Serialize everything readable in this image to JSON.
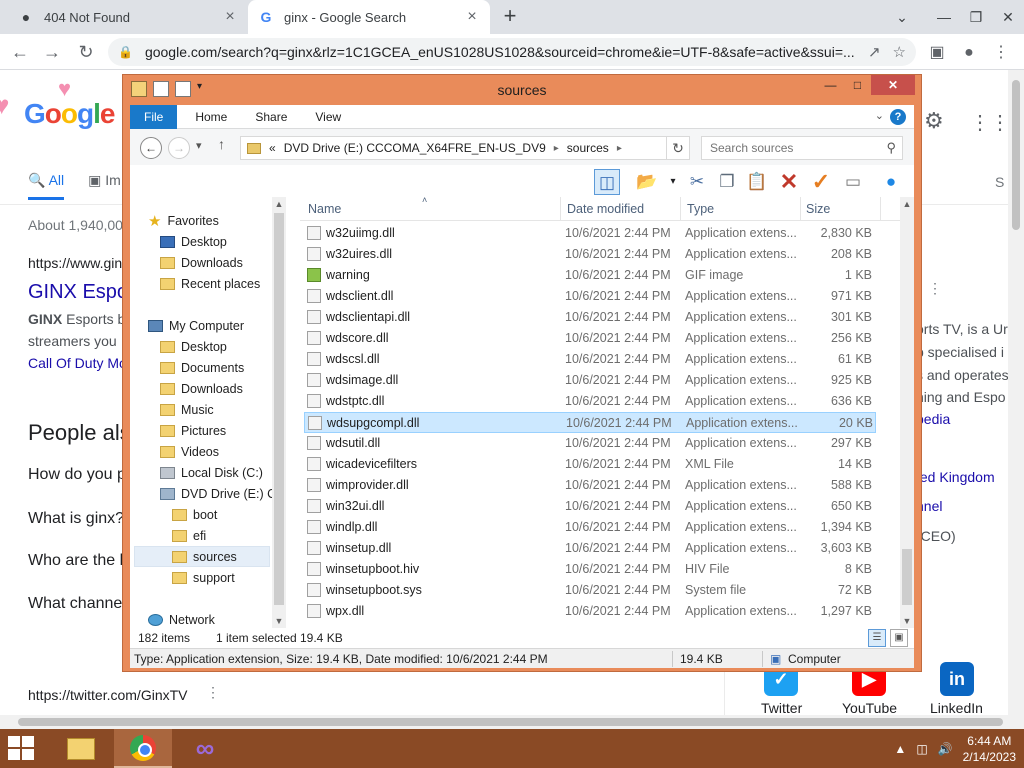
{
  "browser": {
    "tabs": [
      {
        "title": "404 Not Found",
        "icon": "github-icon"
      },
      {
        "title": "ginx - Google Search",
        "icon": "google-icon"
      }
    ],
    "url": "google.com/search?q=ginx&rlz=1C1GCEA_enUS1028US1028&sourceid=chrome&ie=UTF-8&safe=active&ssui=..."
  },
  "google": {
    "tabs": [
      "All",
      "Im"
    ],
    "result_count": "About 1,940,00",
    "result_url": "https://www.gin",
    "result_title": "GINX Espo",
    "snippet_bold": "GINX",
    "snippet_line1": " Esports b",
    "snippet_line2": "streamers you",
    "snippet_link": "Call Of Duty Mo",
    "paa_title": "People als",
    "questions": [
      "How do you p",
      "What is ginx?",
      "Who are the l",
      "What channe"
    ],
    "twitter_url": "https://twitter.com/GinxTV",
    "right_panel": {
      "line1": "orts TV, is a Ur",
      "line2": "p specialised i",
      "line3": "s and operates",
      "line4": "ning and Espo",
      "wiki": "pedia",
      "country": "ted Kingdom",
      "channel": "nnel",
      "ceo": "(CEO)",
      "partial_s": "S"
    },
    "socials": [
      "Twitter",
      "YouTube",
      "LinkedIn"
    ]
  },
  "explorer": {
    "title": "sources",
    "ribbon_tabs": [
      "File",
      "Home",
      "Share",
      "View"
    ],
    "address": {
      "prefix": "«",
      "drive": "DVD Drive (E:) CCCOMA_X64FRE_EN-US_DV9",
      "folder": "sources"
    },
    "search_placeholder": "Search sources",
    "nav": {
      "favorites": "Favorites",
      "desktop": "Desktop",
      "downloads": "Downloads",
      "recent": "Recent places",
      "mycomputer": "My Computer",
      "mc_desktop": "Desktop",
      "mc_documents": "Documents",
      "mc_downloads": "Downloads",
      "mc_music": "Music",
      "mc_pictures": "Pictures",
      "mc_videos": "Videos",
      "local_disk": "Local Disk (C:)",
      "dvd": "DVD Drive (E:) CC",
      "boot": "boot",
      "efi": "efi",
      "sources": "sources",
      "support": "support",
      "network": "Network"
    },
    "columns": {
      "name": "Name",
      "date": "Date modified",
      "type": "Type",
      "size": "Size"
    },
    "files": [
      {
        "name": "w32uiimg.dll",
        "date": "10/6/2021 2:44 PM",
        "type": "Application extens...",
        "size": "2,830 KB"
      },
      {
        "name": "w32uires.dll",
        "date": "10/6/2021 2:44 PM",
        "type": "Application extens...",
        "size": "208 KB"
      },
      {
        "name": "warning",
        "date": "10/6/2021 2:44 PM",
        "type": "GIF image",
        "size": "1 KB"
      },
      {
        "name": "wdsclient.dll",
        "date": "10/6/2021 2:44 PM",
        "type": "Application extens...",
        "size": "971 KB"
      },
      {
        "name": "wdsclientapi.dll",
        "date": "10/6/2021 2:44 PM",
        "type": "Application extens...",
        "size": "301 KB"
      },
      {
        "name": "wdscore.dll",
        "date": "10/6/2021 2:44 PM",
        "type": "Application extens...",
        "size": "256 KB"
      },
      {
        "name": "wdscsl.dll",
        "date": "10/6/2021 2:44 PM",
        "type": "Application extens...",
        "size": "61 KB"
      },
      {
        "name": "wdsimage.dll",
        "date": "10/6/2021 2:44 PM",
        "type": "Application extens...",
        "size": "925 KB"
      },
      {
        "name": "wdstptc.dll",
        "date": "10/6/2021 2:44 PM",
        "type": "Application extens...",
        "size": "636 KB"
      },
      {
        "name": "wdsupgcompl.dll",
        "date": "10/6/2021 2:44 PM",
        "type": "Application extens...",
        "size": "20 KB"
      },
      {
        "name": "wdsutil.dll",
        "date": "10/6/2021 2:44 PM",
        "type": "Application extens...",
        "size": "297 KB"
      },
      {
        "name": "wicadevicefilters",
        "date": "10/6/2021 2:44 PM",
        "type": "XML File",
        "size": "14 KB"
      },
      {
        "name": "wimprovider.dll",
        "date": "10/6/2021 2:44 PM",
        "type": "Application extens...",
        "size": "588 KB"
      },
      {
        "name": "win32ui.dll",
        "date": "10/6/2021 2:44 PM",
        "type": "Application extens...",
        "size": "650 KB"
      },
      {
        "name": "windlp.dll",
        "date": "10/6/2021 2:44 PM",
        "type": "Application extens...",
        "size": "1,394 KB"
      },
      {
        "name": "winsetup.dll",
        "date": "10/6/2021 2:44 PM",
        "type": "Application extens...",
        "size": "3,603 KB"
      },
      {
        "name": "winsetupboot.hiv",
        "date": "10/6/2021 2:44 PM",
        "type": "HIV File",
        "size": "8 KB"
      },
      {
        "name": "winsetupboot.sys",
        "date": "10/6/2021 2:44 PM",
        "type": "System file",
        "size": "72 KB"
      },
      {
        "name": "wpx.dll",
        "date": "10/6/2021 2:44 PM",
        "type": "Application extens...",
        "size": "1,297 KB"
      }
    ],
    "selected_file": "wdsupgcompl.dll",
    "status": {
      "item_count": "182 items",
      "selected": "1 item selected",
      "selected_size": "19.4 KB",
      "details": "Type: Application extension, Size: 19.4 KB, Date modified: 10/6/2021 2:44 PM",
      "size2": "19.4 KB",
      "location": "Computer"
    }
  },
  "taskbar": {
    "time": "6:44 AM",
    "date": "2/14/2023"
  }
}
